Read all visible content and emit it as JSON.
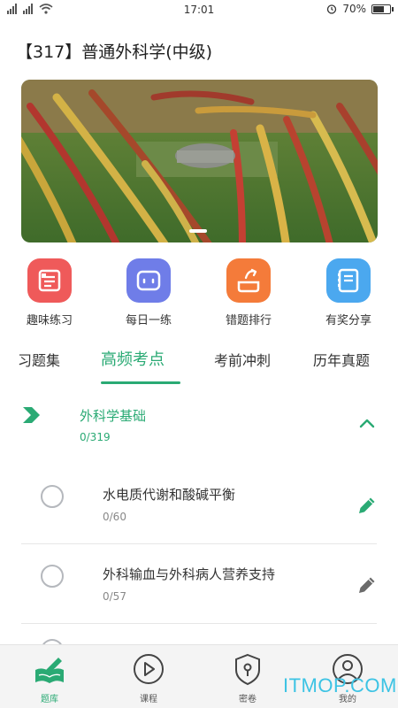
{
  "status_bar": {
    "time": "17:01",
    "battery": "70%"
  },
  "page": {
    "title": "【317】普通外科学(中级)"
  },
  "features": [
    {
      "label": "趣味练习",
      "icon": "practice-icon",
      "color": "#ef5a5a"
    },
    {
      "label": "每日一练",
      "icon": "daily-icon",
      "color": "#6f7de8"
    },
    {
      "label": "错题排行",
      "icon": "ranking-icon",
      "color": "#f47b3a"
    },
    {
      "label": "有奖分享",
      "icon": "share-icon",
      "color": "#4ba8ef"
    }
  ],
  "tabs": [
    {
      "label": "习题集",
      "active": false
    },
    {
      "label": "高频考点",
      "active": true
    },
    {
      "label": "考前冲刺",
      "active": false
    },
    {
      "label": "历年真题",
      "active": false
    }
  ],
  "section": {
    "title": "外科学基础",
    "progress": "0/319"
  },
  "items": [
    {
      "title": "水电质代谢和酸碱平衡",
      "progress": "0/60",
      "edit_active": true
    },
    {
      "title": "外科输血与外科病人营养支持",
      "progress": "0/57",
      "edit_active": false
    }
  ],
  "bottom_nav": [
    {
      "label": "题库",
      "icon": "question-bank-icon",
      "active": true
    },
    {
      "label": "课程",
      "icon": "play-icon",
      "active": false
    },
    {
      "label": "密卷",
      "icon": "lock-icon",
      "active": false
    },
    {
      "label": "我的",
      "icon": "user-icon",
      "active": false
    }
  ],
  "watermark": "ITMOP.COM",
  "colors": {
    "accent": "#2aaa74",
    "text": "#333333",
    "muted": "#888888"
  }
}
